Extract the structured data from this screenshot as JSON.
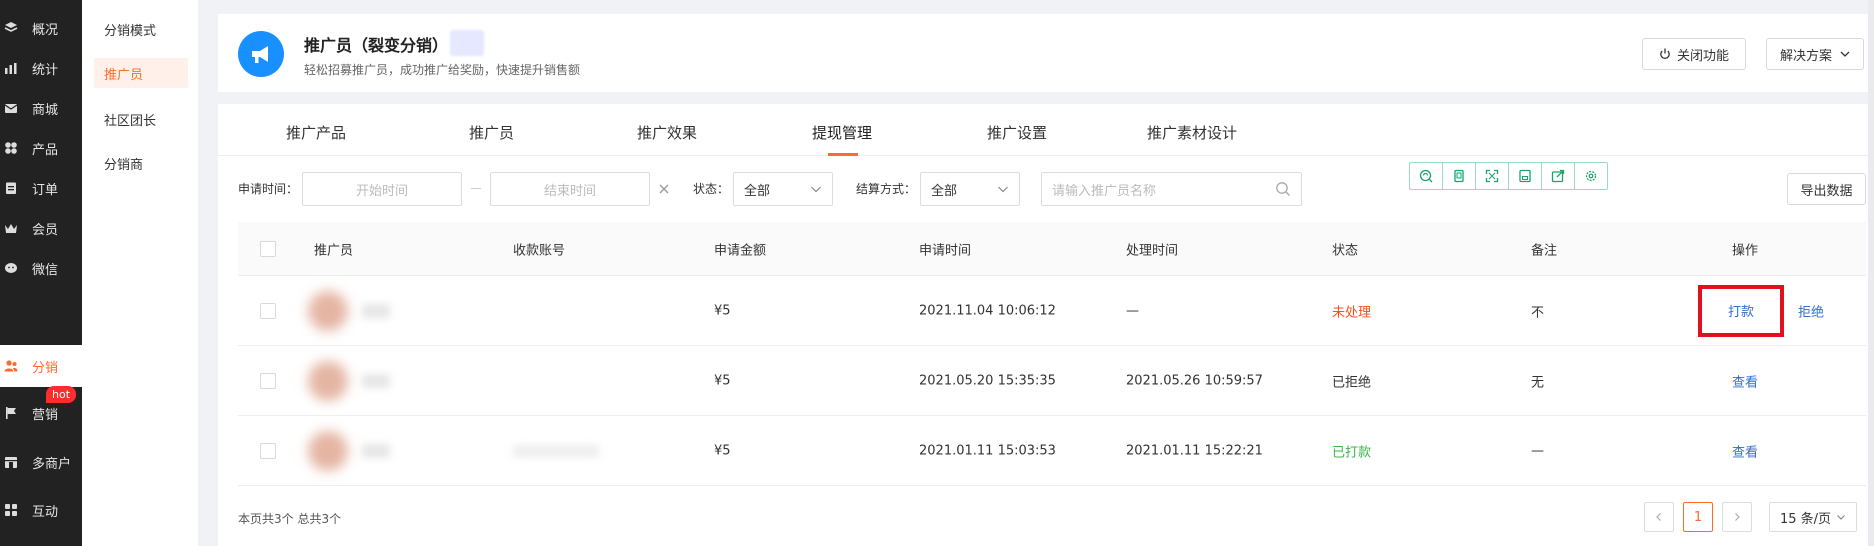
{
  "nav": {
    "items": [
      {
        "label": "概况",
        "icon": "layers-icon"
      },
      {
        "label": "统计",
        "icon": "chart-icon"
      },
      {
        "label": "商城",
        "icon": "mail-icon"
      },
      {
        "label": "产品",
        "icon": "grid-icon"
      },
      {
        "label": "订单",
        "icon": "order-icon"
      },
      {
        "label": "会员",
        "icon": "crown-icon"
      },
      {
        "label": "微信",
        "icon": "wechat-icon"
      },
      {
        "label": "分销",
        "icon": "users-icon"
      },
      {
        "label": "营销",
        "icon": "flag-icon"
      },
      {
        "label": "多商户",
        "icon": "store-icon"
      },
      {
        "label": "互动",
        "icon": "apps-icon"
      }
    ],
    "active_index": 7,
    "hot_badge": "hot"
  },
  "subnav": {
    "items": [
      "分销模式",
      "推广员",
      "社区团长",
      "分销商"
    ],
    "active_index": 1
  },
  "header": {
    "title": "推广员（裂变分销）",
    "subtitle": "轻松招募推广员，成功推广给奖励，快速提升销售额",
    "close_label": "关闭功能",
    "solution_label": "解决方案"
  },
  "tabs": [
    {
      "label": "推广产品"
    },
    {
      "label": "推广员"
    },
    {
      "label": "推广效果"
    },
    {
      "label": "提现管理"
    },
    {
      "label": "推广设置"
    },
    {
      "label": "推广素材设计"
    }
  ],
  "active_tab": 3,
  "filters": {
    "apply_time_label": "申请时间：",
    "start_placeholder": "开始时间",
    "end_placeholder": "结束时间",
    "status_label": "状态：",
    "status_value": "全部",
    "settle_label": "结算方式：",
    "settle_value": "全部",
    "search_placeholder": "请输入推广员名称",
    "export_label": "导出数据"
  },
  "table": {
    "headers": [
      "推广员",
      "收款账号",
      "申请金额",
      "申请时间",
      "处理时间",
      "状态",
      "备注",
      "操作"
    ],
    "rows": [
      {
        "amount": "¥5",
        "apply_time": "2021.11.04 10:06:12",
        "process_time": "—",
        "status": "未处理",
        "status_color": "#ff4d1c",
        "note": "不",
        "action1": "打款",
        "action2": "拒绝"
      },
      {
        "amount": "¥5",
        "apply_time": "2021.05.20 15:35:35",
        "process_time": "2021.05.26 10:59:57",
        "status": "已拒绝",
        "status_color": "#333333",
        "note": "无",
        "action1": "查看"
      },
      {
        "amount": "¥5",
        "apply_time": "2021.01.11 15:03:53",
        "process_time": "2021.01.11 15:22:21",
        "status": "已打款",
        "status_color": "#3bb54a",
        "note": "—",
        "action1": "查看"
      }
    ]
  },
  "footer": {
    "summary": "本页共3个 总共3个",
    "current_page": "1",
    "page_size": "15 条/页"
  },
  "colors": {
    "accent": "#ff6a2f",
    "link": "#2f6fcf",
    "highlight": "#e0101e"
  }
}
